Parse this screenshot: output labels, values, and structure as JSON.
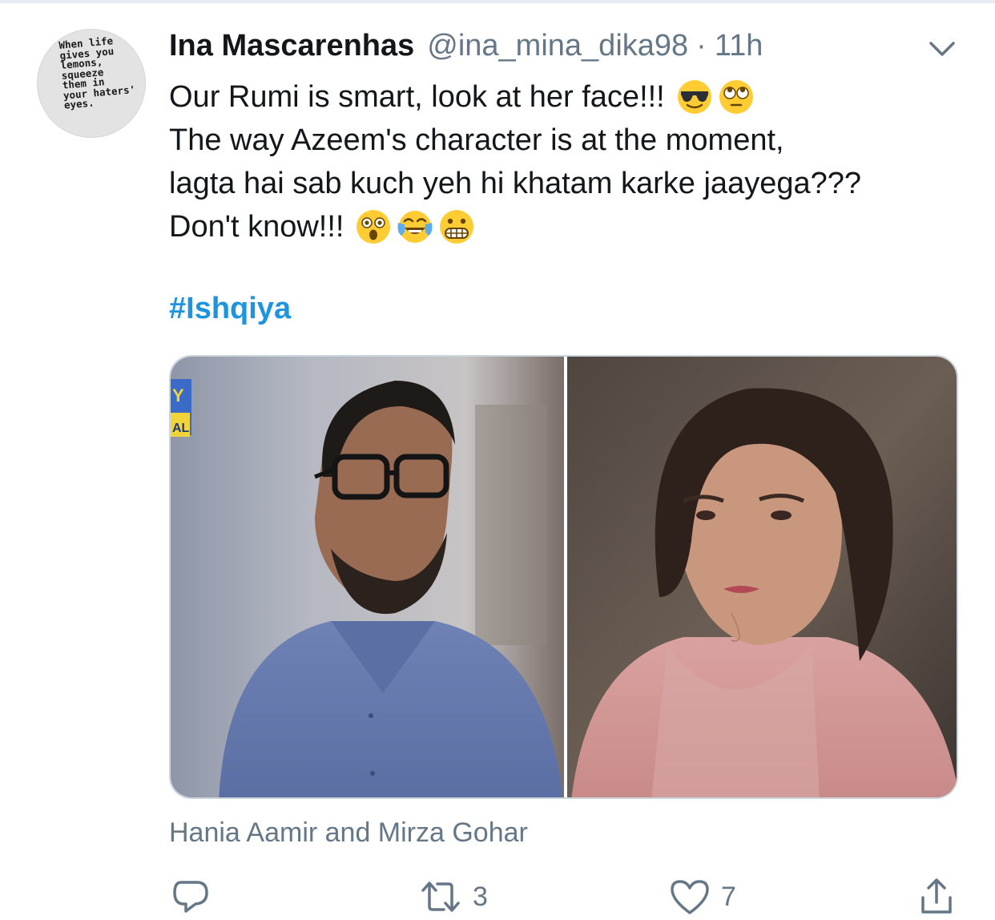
{
  "tweet": {
    "avatar_text": "When life\ngives you\nlemons,\nsqueeze\nthem in\nyour haters'\neyes.",
    "author_name": "Ina Mascarenhas",
    "handle": "@ina_mina_dika98",
    "separator": "·",
    "time": "11h",
    "lines": [
      "Our Rumi is smart, look at her face!!!",
      "The way Azeem's character is  at the moment,",
      "lagta hai sab kuch yeh hi khatam karke jaayega???",
      "Don't know!!!"
    ],
    "line1_emojis": [
      "sunglasses-face",
      "rolling-eyes-face"
    ],
    "line4_emojis": [
      "astonished-face",
      "tears-of-joy-face",
      "grimacing-face"
    ],
    "hashtag": "#Ishqiya",
    "media_channel_badge": [
      "Y",
      "AL"
    ],
    "media_caption": "Hania Aamir and Mirza Gohar",
    "actions": {
      "reply_count": "",
      "retweet_count": "3",
      "like_count": "7"
    }
  },
  "colors": {
    "text_primary": "#14171a",
    "text_secondary": "#657786",
    "link": "#1b95e0",
    "border": "#ccd6dd"
  },
  "icons": [
    "chevron-down-icon",
    "reply-icon",
    "retweet-icon",
    "like-icon",
    "share-icon"
  ]
}
